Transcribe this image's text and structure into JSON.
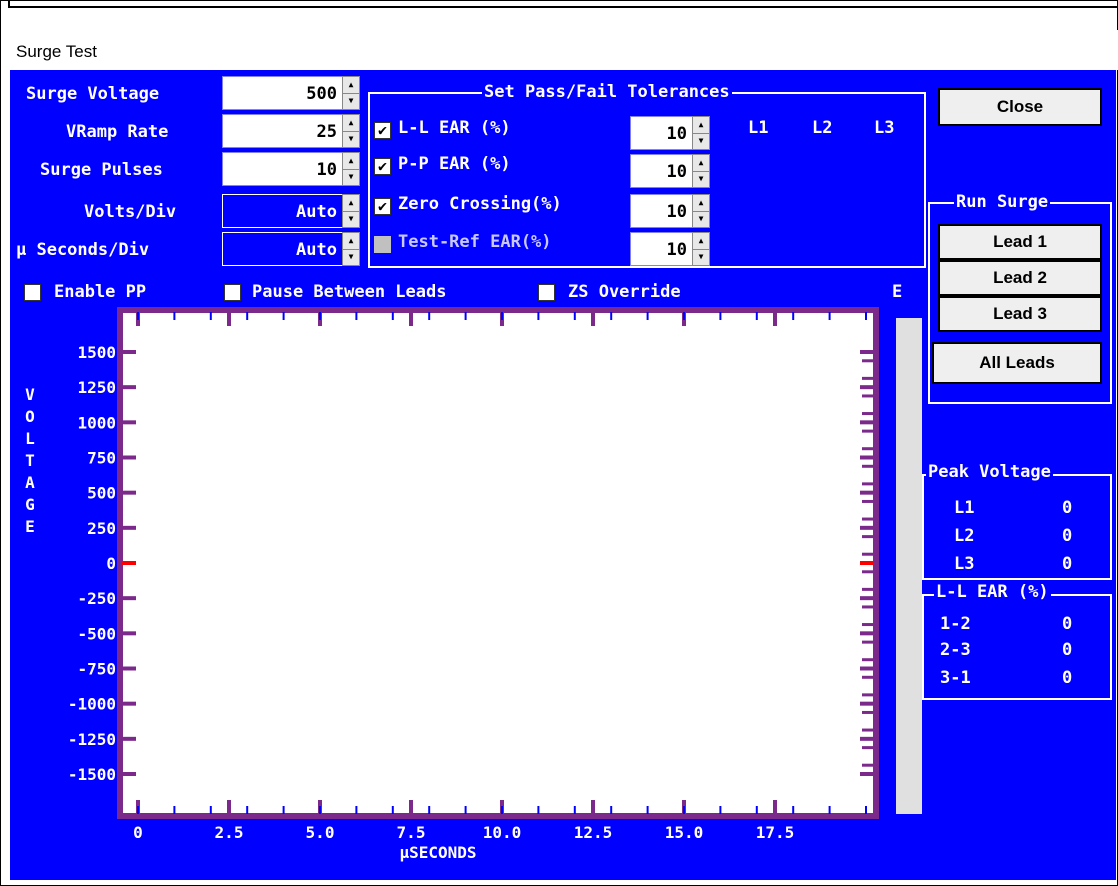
{
  "window": {
    "title": "Surge Test"
  },
  "settings": {
    "surge_voltage_label": "Surge Voltage",
    "surge_voltage_value": "500",
    "vramp_label": "VRamp Rate",
    "vramp_value": "25",
    "pulses_label": "Surge Pulses",
    "pulses_value": "10",
    "volts_div_label": "Volts/Div",
    "volts_div_value": "Auto",
    "useconds_div_label": "µ Seconds/Div",
    "useconds_div_value": "Auto"
  },
  "tolerances": {
    "title": "Set Pass/Fail Tolerances",
    "ll_ear_label": "L-L EAR (%)",
    "ll_ear_value": "10",
    "ll_ear_checked": "✔",
    "pp_ear_label": "P-P EAR (%)",
    "pp_ear_value": "10",
    "pp_ear_checked": "✔",
    "zero_crossing_label": "Zero Crossing(%)",
    "zero_crossing_value": "10",
    "zero_crossing_checked": "✔",
    "test_ref_label": "Test-Ref EAR(%)",
    "test_ref_value": "10",
    "col_l1": "L1",
    "col_l2": "L2",
    "col_l3": "L3"
  },
  "options": {
    "enable_pp": "Enable PP",
    "pause_between_leads": "Pause Between Leads",
    "zs_override": "ZS Override",
    "e_label": "E"
  },
  "buttons": {
    "close": "Close",
    "run_surge_title": "Run Surge",
    "lead1": "Lead 1",
    "lead2": "Lead 2",
    "lead3": "Lead 3",
    "all_leads": "All Leads"
  },
  "peak_voltage": {
    "title": "Peak Voltage",
    "rows": [
      {
        "label": "L1",
        "value": "0"
      },
      {
        "label": "L2",
        "value": "0"
      },
      {
        "label": "L3",
        "value": "0"
      }
    ]
  },
  "ll_ear": {
    "title": "L-L EAR (%)",
    "rows": [
      {
        "label": "1-2",
        "value": "0"
      },
      {
        "label": "2-3",
        "value": "0"
      },
      {
        "label": "3-1",
        "value": "0"
      }
    ]
  },
  "chart_data": {
    "type": "line",
    "ylabel": "VOLTAGE",
    "xlabel": "µSECONDS",
    "y_ticks": [
      "1500",
      "1250",
      "1000",
      "750",
      "500",
      "250",
      "0",
      "-250",
      "-500",
      "-750",
      "-1000",
      "-1250",
      "-1500"
    ],
    "x_ticks": [
      "0",
      "2.5",
      "5.0",
      "7.5",
      "10.0",
      "12.5",
      "15.0",
      "17.5"
    ],
    "ylim": [
      -1500,
      1500
    ],
    "xlim": [
      0,
      20
    ],
    "zero_marker_color": "#ff0000",
    "frame_color": "#7b2a8c",
    "series": []
  }
}
